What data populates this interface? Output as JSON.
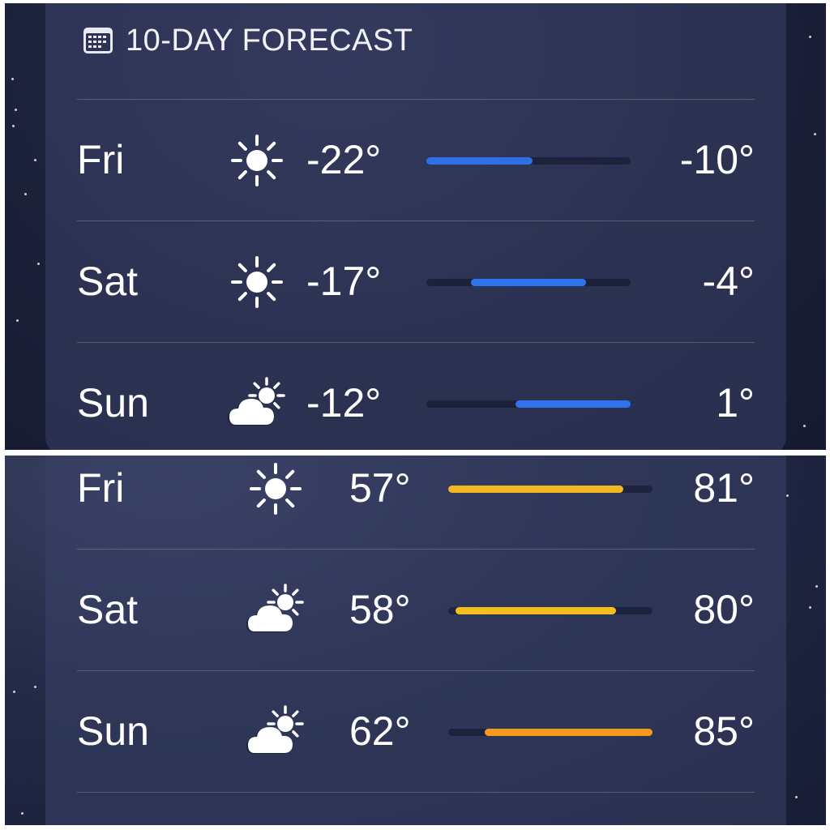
{
  "top": {
    "header": {
      "title": "10-DAY FORECAST",
      "icon": "calendar-icon"
    },
    "scale": {
      "min": -22,
      "max": 1
    },
    "days": [
      {
        "day": "Fri",
        "icon": "sun-icon",
        "low": "-22°",
        "high": "-10°",
        "low_value": -22,
        "high_value": -10,
        "color": "#2f6fe8"
      },
      {
        "day": "Sat",
        "icon": "sun-icon",
        "low": "-17°",
        "high": "-4°",
        "low_value": -17,
        "high_value": -4,
        "color": "#2f74ee"
      },
      {
        "day": "Sun",
        "icon": "partly-cloudy-icon",
        "low": "-12°",
        "high": "1°",
        "low_value": -12,
        "high_value": 1,
        "color": "#2f74ee"
      }
    ]
  },
  "bottom": {
    "scale": {
      "min": 57,
      "max": 85
    },
    "days": [
      {
        "day": "Fri",
        "icon": "sun-icon",
        "low": "57°",
        "high": "81°",
        "low_value": 57,
        "high_value": 81,
        "color": "#f2b820"
      },
      {
        "day": "Sat",
        "icon": "partly-cloudy-icon",
        "low": "58°",
        "high": "80°",
        "low_value": 58,
        "high_value": 80,
        "color": "#f5be1d"
      },
      {
        "day": "Sun",
        "icon": "partly-cloudy-icon",
        "low": "62°",
        "high": "85°",
        "low_value": 62,
        "high_value": 85,
        "color": "#f59a1f"
      }
    ]
  }
}
